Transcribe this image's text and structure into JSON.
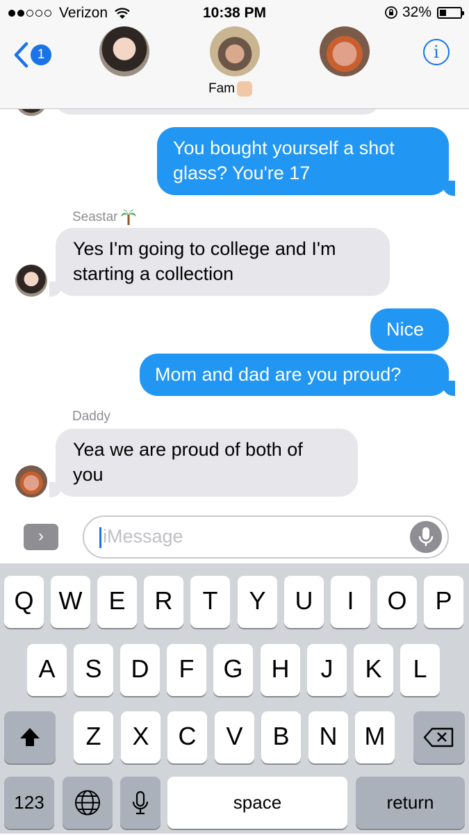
{
  "status_bar": {
    "carrier": "Verizon",
    "time": "10:38 PM",
    "battery": "32%",
    "battery_level": 0.32,
    "signal_bars_filled": 2,
    "signal_bars_total": 5
  },
  "header": {
    "back_count": "1",
    "group_name": "Fam",
    "info_label": "i"
  },
  "messages": [
    {
      "direction": "outgoing",
      "lines": [
        "You bought yourself a shot",
        "glass? You're 17"
      ]
    },
    {
      "direction": "incoming",
      "sender": "Seastar",
      "lines": [
        "Yes I'm going to college and I'm",
        "starting a collection"
      ]
    },
    {
      "direction": "outgoing",
      "lines": [
        "Nice"
      ]
    },
    {
      "direction": "outgoing",
      "lines": [
        "Mom and dad are you proud?"
      ]
    },
    {
      "direction": "incoming",
      "sender": "Daddy",
      "lines": [
        "Yea we are proud of both of",
        "you"
      ]
    }
  ],
  "input": {
    "placeholder": "iMessage",
    "apps_glyph": "›"
  },
  "keyboard": {
    "row1": [
      "Q",
      "W",
      "E",
      "R",
      "T",
      "Y",
      "U",
      "I",
      "O",
      "P"
    ],
    "row2": [
      "A",
      "S",
      "D",
      "F",
      "G",
      "H",
      "J",
      "K",
      "L"
    ],
    "row3": [
      "Z",
      "X",
      "C",
      "V",
      "B",
      "N",
      "M"
    ],
    "numbers": "123",
    "space": "space",
    "return": "return"
  },
  "colors": {
    "outgoing_bubble": "#2196f3",
    "incoming_bubble": "#e6e6eb",
    "accent": "#1a73e8"
  },
  "icons": [
    "wifi-icon",
    "rotation-lock-icon",
    "back-chevron-icon",
    "info-icon",
    "palm-tree-icon",
    "microphone-icon",
    "shift-icon",
    "backspace-icon",
    "globe-icon"
  ]
}
